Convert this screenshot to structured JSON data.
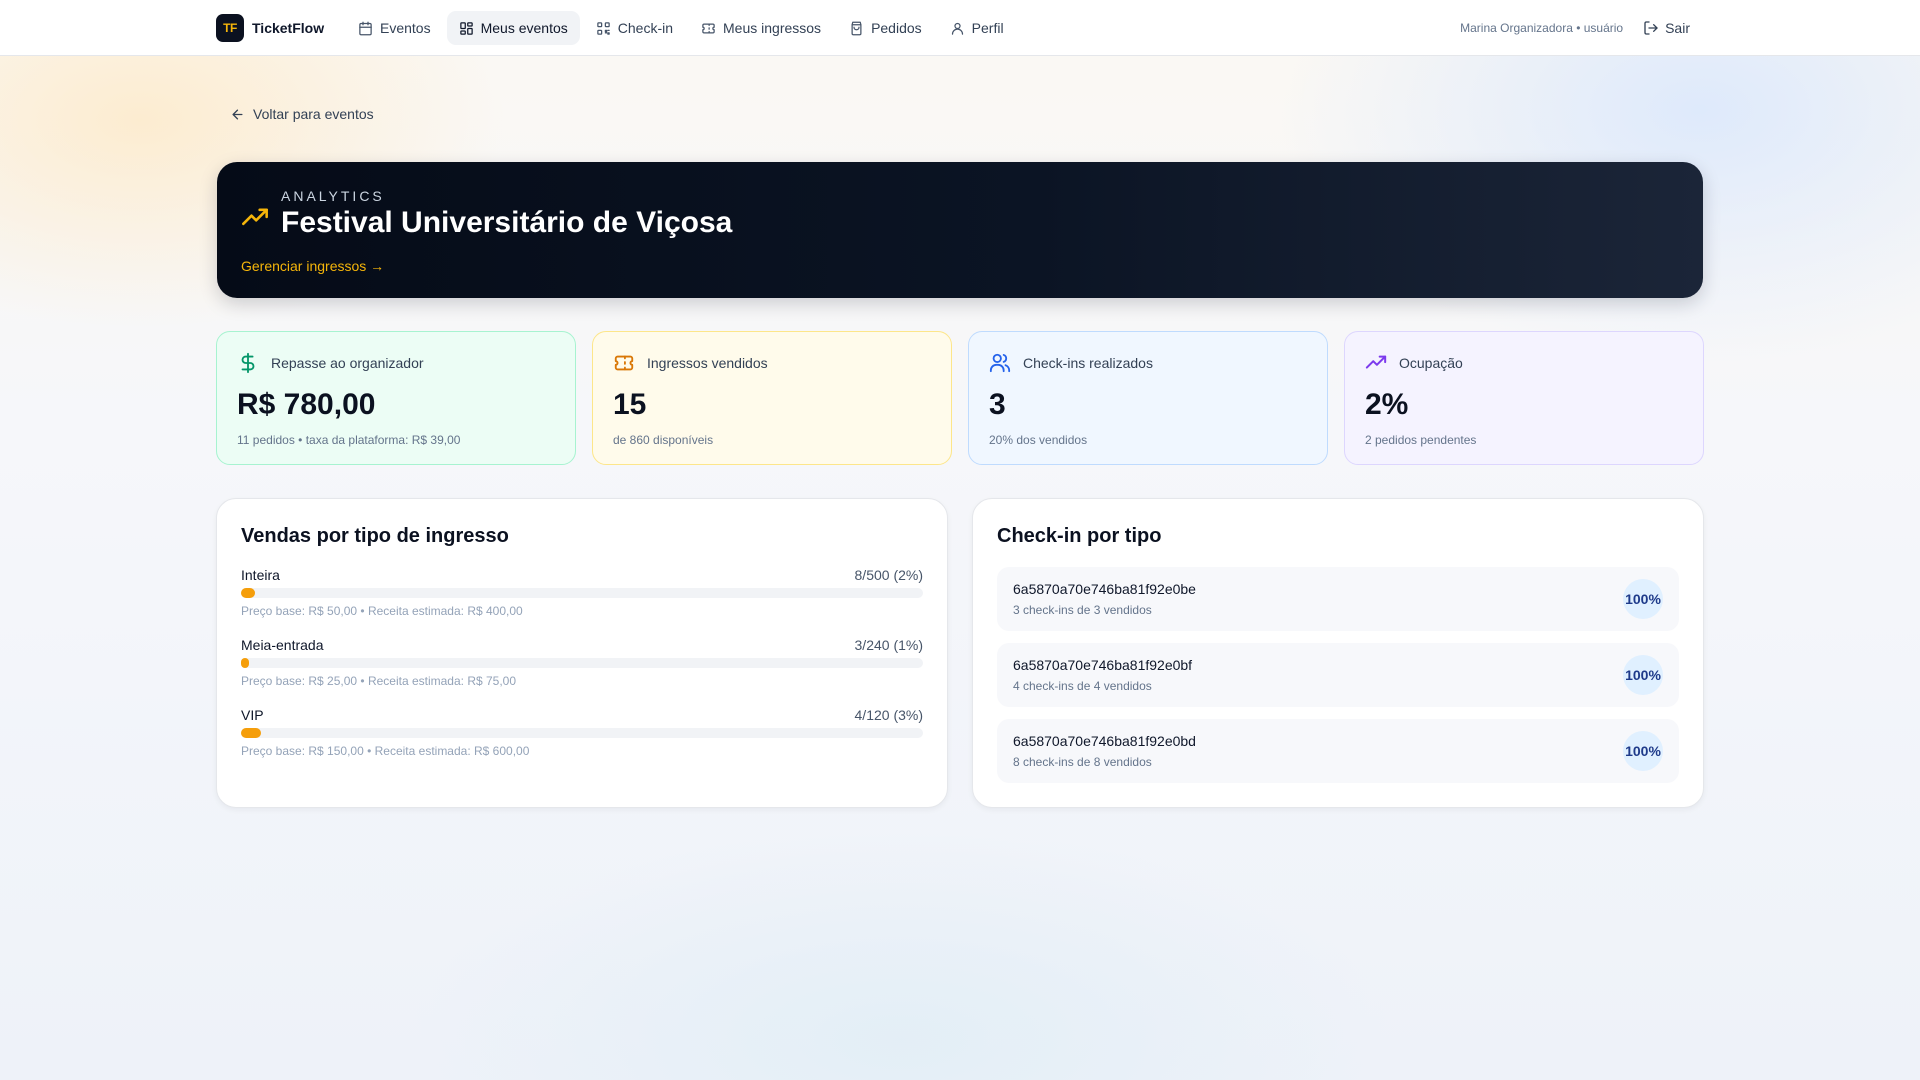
{
  "nav": {
    "brand_mark": "TF",
    "brand_name": "TicketFlow",
    "items": [
      {
        "label": "Eventos",
        "icon": "calendar-icon"
      },
      {
        "label": "Meus eventos",
        "icon": "grid-icon"
      },
      {
        "label": "Check-in",
        "icon": "qr-icon"
      },
      {
        "label": "Meus ingressos",
        "icon": "ticket-icon"
      },
      {
        "label": "Pedidos",
        "icon": "bag-icon"
      },
      {
        "label": "Perfil",
        "icon": "user-icon"
      }
    ],
    "active_item": "Meus eventos",
    "user_label": "Marina Organizadora • usuário",
    "logout_label": "Sair"
  },
  "back_link": "Voltar para eventos",
  "hero": {
    "eyebrow": "ANALYTICS",
    "title": "Festival Universitário de Viçosa",
    "manage_link": "Gerenciar ingressos →",
    "accent_color": "#f5b50a"
  },
  "stats": [
    {
      "label": "Repasse ao organizador",
      "value": "R$ 780,00",
      "sub": "11 pedidos • taxa da plataforma: R$ 39,00",
      "icon": "dollar-icon",
      "color": "#059669"
    },
    {
      "label": "Ingressos vendidos",
      "value": "15",
      "sub": "de 860 disponíveis",
      "icon": "ticket-icon",
      "color": "#d97706"
    },
    {
      "label": "Check-ins realizados",
      "value": "3",
      "sub": "20% dos vendidos",
      "icon": "users-icon",
      "color": "#2563eb"
    },
    {
      "label": "Ocupação",
      "value": "2%",
      "sub": "2 pedidos pendentes",
      "icon": "trending-up-icon",
      "color": "#7c3aed"
    }
  ],
  "sales": {
    "title": "Vendas por tipo de ingresso",
    "rows": [
      {
        "name": "Inteira",
        "count": "8/500 (2%)",
        "fraction": 0.02,
        "meta": "Preço base: R$ 50,00 • Receita estimada: R$ 400,00"
      },
      {
        "name": "Meia-entrada",
        "count": "3/240 (1%)",
        "fraction": 0.01,
        "meta": "Preço base: R$ 25,00 • Receita estimada: R$ 75,00"
      },
      {
        "name": "VIP",
        "count": "4/120 (3%)",
        "fraction": 0.03,
        "meta": "Preço base: R$ 150,00 • Receita estimada: R$ 600,00"
      }
    ]
  },
  "checkins": {
    "title": "Check-in por tipo",
    "rows": [
      {
        "id": "6a5870a70e746ba81f92e0be",
        "sub": "3 check-ins de 3 vendidos",
        "pct": "100%"
      },
      {
        "id": "6a5870a70e746ba81f92e0bf",
        "sub": "4 check-ins de 4 vendidos",
        "pct": "100%"
      },
      {
        "id": "6a5870a70e746ba81f92e0bd",
        "sub": "8 check-ins de 8 vendidos",
        "pct": "100%"
      }
    ]
  }
}
